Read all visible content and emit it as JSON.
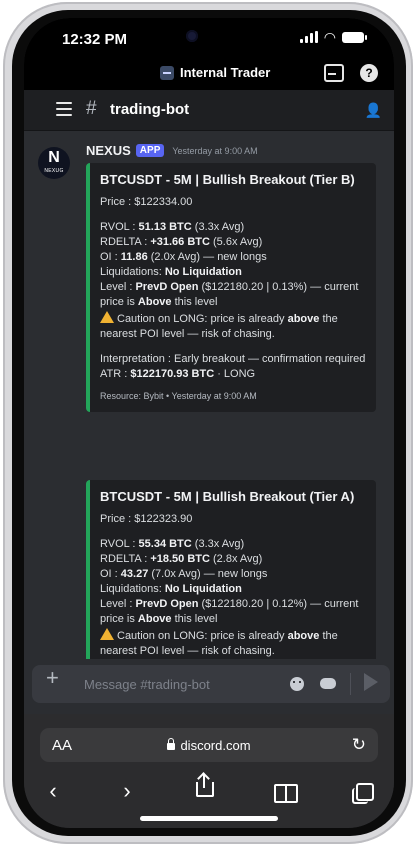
{
  "status_bar": {
    "time": "12:32 PM"
  },
  "server": {
    "name": "Internal Trader"
  },
  "channel": {
    "name": "trading-bot"
  },
  "message": {
    "author": "NEXUS",
    "badge": "APP",
    "timestamp": "Yesterday at 9:00 AM",
    "avatar_text": "N",
    "avatar_subtext": "NEXUG"
  },
  "embeds": [
    {
      "title": "BTCUSDT - 5M | Bullish Breakout (Tier B)",
      "price_label": "Price : ",
      "price": "$122334.00",
      "rvol_label": "RVOL : ",
      "rvol_value": "51.13 BTC",
      "rvol_avg": " (3.3x Avg)",
      "rdelta_label": "RDELTA : ",
      "rdelta_value": "+31.66 BTC",
      "rdelta_avg": " (5.6x Avg)",
      "oi_label": "OI : ",
      "oi_value": "11.86",
      "oi_avg": " (2.0x Avg) — new longs",
      "liq_label": "Liquidations: ",
      "liq_value": "No Liquidation",
      "level_label": "Level : ",
      "level_value": "PrevD Open",
      "level_detail": " ($122180.20 | 0.13%) — current price is ",
      "level_pos": "Above",
      "level_tail": " this level",
      "caution_a": "Caution on LONG: price is already ",
      "caution_b": "above",
      "caution_c": " the nearest POI level — risk of chasing.",
      "interp": "Interpretation : Early breakout — confirmation required",
      "atr_label": "ATR : ",
      "atr_value": "$122170.93 BTC",
      "atr_tail": " · LONG",
      "footer": "Resource: Bybit • Yesterday at 9:00 AM"
    },
    {
      "title": "BTCUSDT - 5M | Bullish Breakout (Tier A)",
      "price_label": "Price : ",
      "price": "$122323.90",
      "rvol_label": "RVOL : ",
      "rvol_value": "55.34 BTC",
      "rvol_avg": " (3.3x Avg)",
      "rdelta_label": "RDELTA : ",
      "rdelta_value": "+18.50 BTC",
      "rdelta_avg": " (2.8x Avg)",
      "oi_label": "OI : ",
      "oi_value": "43.27",
      "oi_avg": " (7.0x Avg) — new longs",
      "liq_label": "Liquidations: ",
      "liq_value": "No Liquidation",
      "level_label": "Level : ",
      "level_value": "PrevD Open",
      "level_detail": " ($122180.20 | 0.12%) — current price is ",
      "level_pos": "Above",
      "level_tail": " this level",
      "caution_a": "Caution on LONG: price is already ",
      "caution_b": "above",
      "caution_c": " the nearest POI level — risk of chasing."
    }
  ],
  "composer": {
    "placeholder": "Message #trading-bot"
  },
  "browser": {
    "aa": "AA",
    "url": "discord.com"
  },
  "colors": {
    "accent": "#23a55a",
    "badge": "#5865f2",
    "warning": "#f0b232"
  }
}
